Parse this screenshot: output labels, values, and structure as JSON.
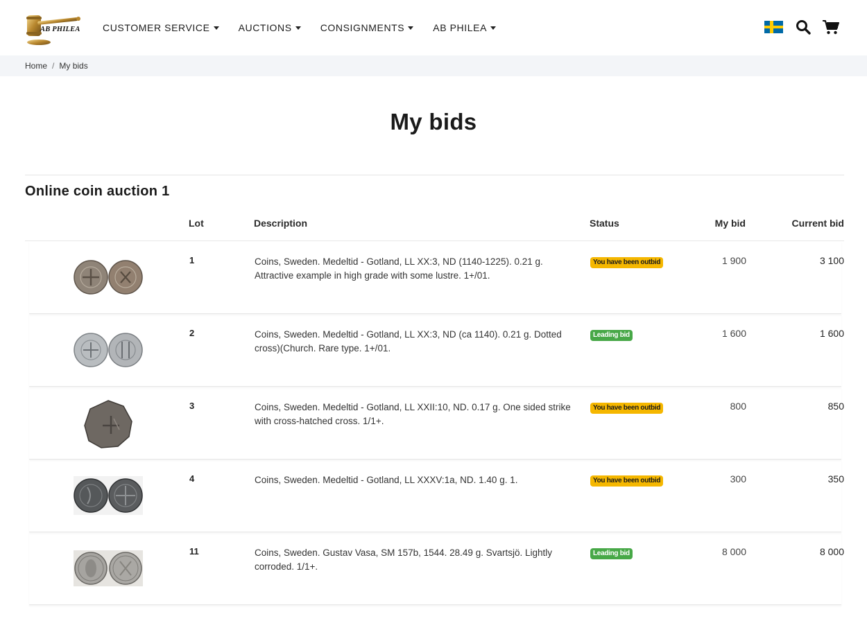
{
  "header": {
    "logo_text": "AB PHILEA",
    "nav": [
      {
        "label": "CUSTOMER SERVICE"
      },
      {
        "label": "AUCTIONS"
      },
      {
        "label": "CONSIGNMENTS"
      },
      {
        "label": "AB PHILEA"
      }
    ],
    "icons": [
      "sweden-flag-icon",
      "search-icon",
      "cart-icon"
    ]
  },
  "breadcrumb": {
    "home": "Home",
    "separator": "/",
    "current": "My bids"
  },
  "page_title": "My bids",
  "auction": {
    "title": "Online coin auction 1",
    "columns": {
      "lot": "Lot",
      "description": "Description",
      "status": "Status",
      "my_bid": "My bid",
      "current_bid": "Current bid"
    },
    "rows": [
      {
        "lot": "1",
        "description": "Coins, Sweden. Medeltid - Gotland, LL XX:3, ND (1140-1225). 0.21 g. Attractive example in high grade with some lustre. 1+/01.",
        "status": "You have been outbid",
        "status_type": "outbid",
        "my_bid": "1 900",
        "current_bid": "3 100",
        "image": "two-coins-silver-brown"
      },
      {
        "lot": "2",
        "description": "Coins, Sweden. Medeltid - Gotland, LL XX:3, ND (ca 1140). 0.21 g. Dotted cross)(Church. Rare type. 1+/01.",
        "status": "Leading bid",
        "status_type": "leading",
        "my_bid": "1 600",
        "current_bid": "1 600",
        "image": "two-coins-silver-light"
      },
      {
        "lot": "3",
        "description": "Coins, Sweden. Medeltid - Gotland, LL XXII:10, ND. 0.17 g. One sided strike with cross-hatched cross. 1/1+.",
        "status": "You have been outbid",
        "status_type": "outbid",
        "my_bid": "800",
        "current_bid": "850",
        "image": "single-coin-dark"
      },
      {
        "lot": "4",
        "description": "Coins, Sweden. Medeltid - Gotland, LL XXXV:1a, ND. 1.40 g. 1.",
        "status": "You have been outbid",
        "status_type": "outbid",
        "my_bid": "300",
        "current_bid": "350",
        "image": "two-coins-dark"
      },
      {
        "lot": "11",
        "description": "Coins, Sweden. Gustav Vasa, SM 157b, 1544. 28.49 g. Svartsjö. Lightly corroded. 1/1+.",
        "status": "Leading bid",
        "status_type": "leading",
        "my_bid": "8 000",
        "current_bid": "8 000",
        "image": "two-coins-large-silver"
      }
    ]
  },
  "colors": {
    "outbid_badge": "#f5b700",
    "leading_badge": "#47a847",
    "breadcrumb_bg": "#f3f5f8"
  }
}
